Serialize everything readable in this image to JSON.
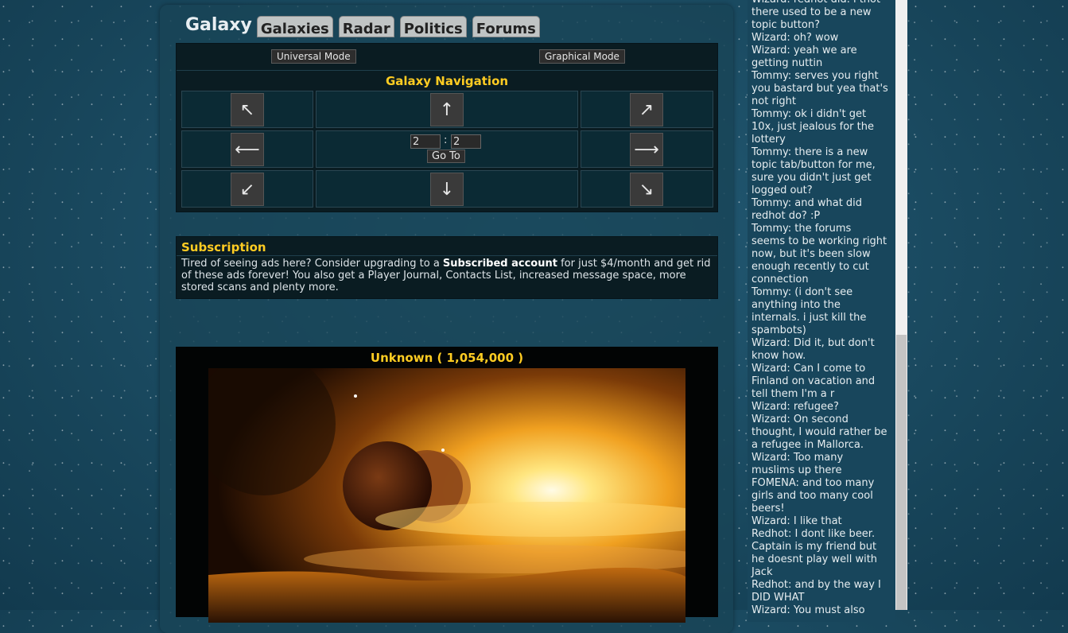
{
  "tabs": {
    "title": "Galaxy",
    "items": [
      "Galaxies",
      "Radar",
      "Politics",
      "Forums"
    ]
  },
  "navigation": {
    "universal_mode": "Universal Mode",
    "graphical_mode": "Graphical Mode",
    "title": "Galaxy Navigation",
    "x_value": "2",
    "separator": ":",
    "y_value": "2",
    "goto_label": "Go To",
    "arrows": {
      "nw": "↖",
      "n": "↑",
      "ne": "↗",
      "w": "⟵",
      "e": "⟶",
      "sw": "↙",
      "s": "↓",
      "se": "↘"
    }
  },
  "subscription": {
    "title": "Subscription",
    "text_before": "Tired of seeing ads here? Consider upgrading to a ",
    "link": "Subscribed account",
    "text_after": " for just $4/month and get rid of these ads forever! You also get a Player Journal, Contacts List, increased message space, more stored scans and plenty more."
  },
  "planet": {
    "title": "Unknown ( 1,054,000 )"
  },
  "chat": [
    "Wizard: redhot did. i thot",
    "there used to be a new",
    "topic button?",
    "Wizard: oh? wow",
    "Wizard: yeah we are",
    "getting nuttin",
    "Tommy: serves you right",
    "you bastard but yea that's",
    "not right",
    "Tommy: ok i didn't get",
    "10x, just jealous for the",
    "lottery",
    "Tommy: there is a new",
    "topic tab/button for me,",
    "sure you didn't just get",
    "logged out?",
    "Tommy: and what did",
    "redhot do? :P",
    "Tommy: the forums",
    "seems to be working right",
    "now, but it's been slow",
    "enough recently to cut",
    "connection",
    "Tommy: (i don't see",
    "anything into the",
    "internals. i just kill the",
    "spambots)",
    "Wizard: Did it, but don't",
    "know how.",
    "Wizard: Can I come to",
    "Finland on vacation and",
    "tell them I'm a r",
    "Wizard: refugee?",
    "Wizard: On second",
    "thought, I would rather be",
    "a refugee in Mallorca.",
    "Wizard: Too many",
    "muslims up there",
    "FOMENA: and too many",
    "girls and too many cool",
    "beers!",
    "Wizard: I like that",
    "Redhot: I dont like beer.",
    "Captain is my friend but",
    "he doesnt play well with",
    "Jack",
    "Redhot: and by the way I",
    "DID WHAT",
    "Wizard: You must also"
  ]
}
